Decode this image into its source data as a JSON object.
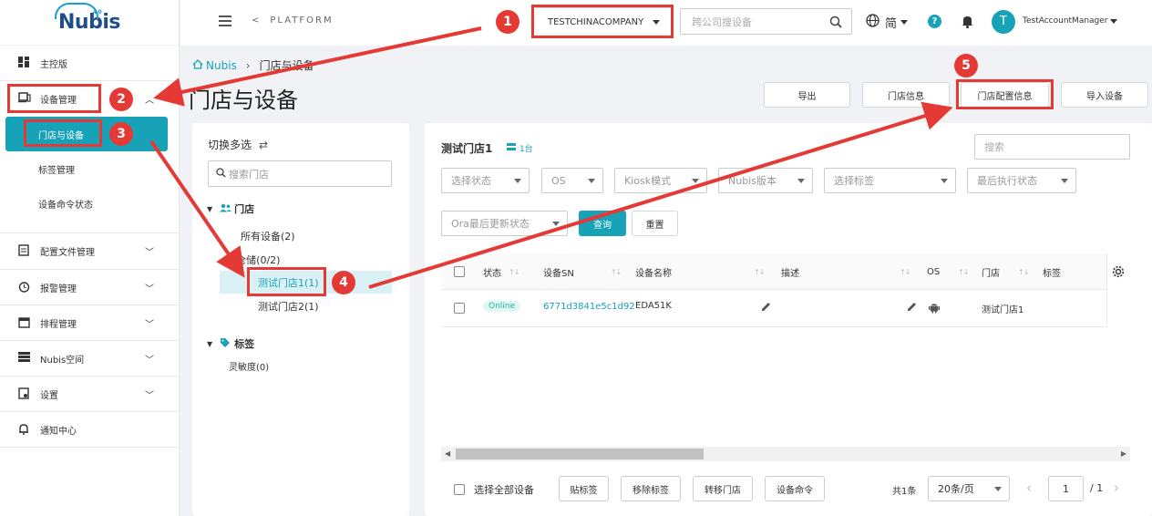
{
  "logo": {
    "text": "Nubis",
    "sup": "4.0"
  },
  "sidebar": {
    "items": [
      {
        "label": "主控版"
      },
      {
        "label": "设备管理"
      },
      {
        "label": "门店与设备"
      },
      {
        "label": "标签管理"
      },
      {
        "label": "设备命令状态"
      },
      {
        "label": "配置文件管理"
      },
      {
        "label": "报警管理"
      },
      {
        "label": "排程管理"
      },
      {
        "label": "Nubis空间"
      },
      {
        "label": "设置"
      },
      {
        "label": "通知中心"
      }
    ]
  },
  "topbar": {
    "platform": "PLATFORM",
    "company": "TESTCHINACOMPANY",
    "search_placeholder": "跨公司搜设备",
    "lang": "简",
    "help": "?",
    "avatar": "T",
    "user": "TestAccountManager"
  },
  "breadcrumb": {
    "home": "Nubis",
    "current": "门店与设备"
  },
  "page_title": "门店与设备",
  "actions": {
    "export": "导出",
    "store_info": "门店信息",
    "store_config": "门店配置信息",
    "import": "导入设备"
  },
  "tree": {
    "toggle": "切换多选",
    "search_placeholder": "搜索门店",
    "stores_label": "门店",
    "all_devices": "所有设备(2)",
    "warehouse": "仓储(0/2)",
    "store1": "测试门店1(1)",
    "store2": "测试门店2(1)",
    "tags_label": "标签",
    "tag1": "灵敏度(0)"
  },
  "main": {
    "store_title": "测试门店1",
    "device_count": "1台",
    "search_placeholder": "搜索",
    "filters": [
      "选择状态",
      "OS",
      "Kiosk模式",
      "Nubis版本",
      "选择标签",
      "最后执行状态",
      "Ora最后更新状态"
    ],
    "query": "查询",
    "reset": "重置",
    "columns": [
      "状态",
      "设备SN",
      "设备名称",
      "描述",
      "OS",
      "门店",
      "标签"
    ],
    "rows": [
      {
        "status": "Online",
        "sn": "6771d3841e5c1d92",
        "name": "EDA51K",
        "store": "测试门店1"
      }
    ]
  },
  "footer": {
    "select_all": "选择全部设备",
    "tag": "贴标签",
    "remove_tag": "移除标签",
    "move_store": "转移门店",
    "device_cmd": "设备命令",
    "total": "共1条",
    "page_size": "20条/页",
    "page": "1",
    "page_total": "/ 1"
  },
  "annotations": {
    "m1": "1",
    "m2": "2",
    "m3": "3",
    "m4": "4",
    "m5": "5"
  },
  "colors": {
    "accent": "#18a2b8",
    "annotation": "#e53935",
    "online_bg": "#e0f7f4",
    "online_text": "#26b5a0"
  }
}
